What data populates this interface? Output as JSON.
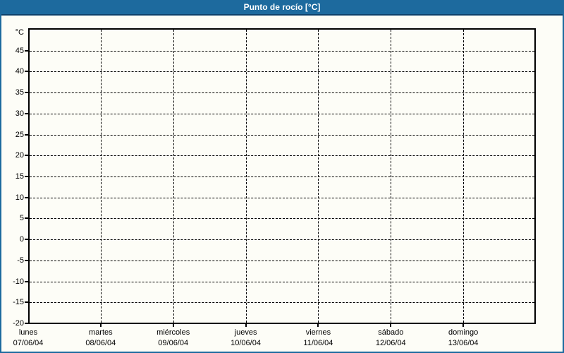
{
  "window": {
    "title": "Punto de rocío [°C]",
    "titlebar_bg": "#1d6a9e",
    "titlebar_text_color": "#ffffff",
    "titlebar_divider_color": "#0d416b",
    "frame_border_color": "#1d6a9e",
    "background": "#fdfdf7"
  },
  "chart_data": {
    "type": "line",
    "title": "Punto de rocío [°C]",
    "y_unit_label": "°C",
    "ylabel": "°C",
    "xlabel": "",
    "ylim": [
      -20,
      50
    ],
    "ytick_step": 5,
    "yticks": [
      45,
      40,
      35,
      30,
      25,
      20,
      15,
      10,
      5,
      0,
      -5,
      -10,
      -15,
      -20
    ],
    "grid": "dashed black horizontal lines at each 5° tick and vertical lines at each day boundary",
    "legend": "none",
    "categories": [
      "07/06/04",
      "08/06/04",
      "09/06/04",
      "10/06/04",
      "11/06/04",
      "12/06/04",
      "13/06/04"
    ],
    "x_days": [
      {
        "name": "lunes",
        "date": "07/06/04"
      },
      {
        "name": "martes",
        "date": "08/06/04"
      },
      {
        "name": "miércoles",
        "date": "09/06/04"
      },
      {
        "name": "jueves",
        "date": "10/06/04"
      },
      {
        "name": "viernes",
        "date": "11/06/04"
      },
      {
        "name": "sábado",
        "date": "12/06/04"
      },
      {
        "name": "domingo",
        "date": "13/06/04"
      }
    ],
    "series": []
  }
}
